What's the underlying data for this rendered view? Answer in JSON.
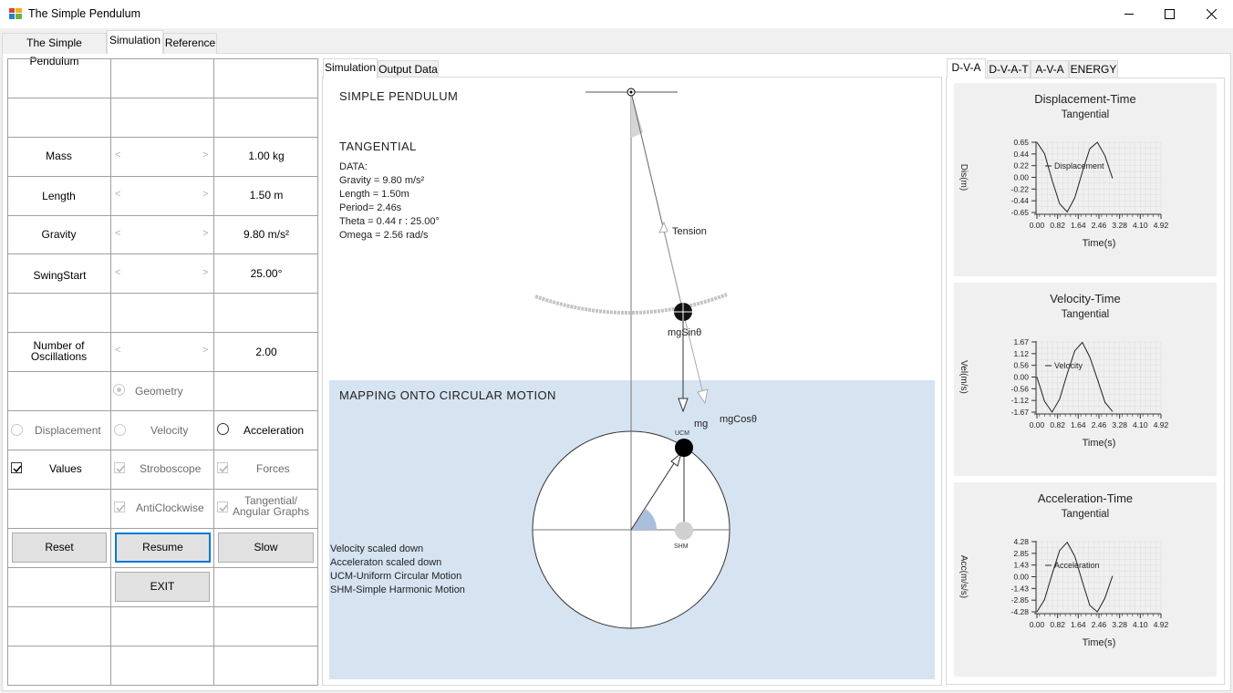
{
  "window": {
    "title": "The Simple Pendulum"
  },
  "main_tabs": [
    "The Simple Pendulum",
    "Simulation",
    "Reference"
  ],
  "controls": {
    "mass": {
      "label": "Mass",
      "value": "1.00 kg"
    },
    "length": {
      "label": "Length",
      "value": "1.50 m"
    },
    "gravity": {
      "label": "Gravity",
      "value": "9.80 m/s²"
    },
    "swing": {
      "label": "SwingStart",
      "value": "25.00°"
    },
    "osc": {
      "label1": "Number of",
      "label2": "Oscillations",
      "value": "2.00"
    },
    "geometry": "Geometry",
    "displacement": "Displacement",
    "velocity": "Velocity",
    "acceleration": "Acceleration",
    "values": "Values",
    "stroboscope": "Stroboscope",
    "forces": "Forces",
    "anticlockwise": "AntiClockwise",
    "tangential1": "Tangential/",
    "tangential2": "Angular Graphs",
    "reset": "Reset",
    "resume": "Resume",
    "slow": "Slow",
    "exit": "EXIT"
  },
  "sim_tabs": [
    "Simulation",
    "Output Data"
  ],
  "sim": {
    "heading": "SIMPLE PENDULUM",
    "mode": "TANGENTIAL",
    "data_lines": [
      "DATA:",
      "Gravity = 9.80 m/s²",
      "Length = 1.50m",
      "Period= 2.46s",
      "Theta = 0.44 r : 25.00°",
      "Omega = 2.56 rad/s"
    ],
    "tension": "Tension",
    "mgsin": "mgSinθ",
    "mg": "mg",
    "mgcos": "mgCosθ",
    "circ_heading": "MAPPING ONTO CIRCULAR MOTION",
    "ucm": "UCM",
    "shm": "SHM",
    "notes": [
      "Velocity scaled down",
      "Acceleraton scaled down",
      "UCM-Uniform Circular Motion",
      "SHM-Simple Harmonic Motion"
    ]
  },
  "graph_tabs": [
    "D-V-A",
    "D-V-A-T",
    "A-V-A",
    "ENERGY"
  ],
  "graphs": [
    {
      "title": "Displacement-Time",
      "sub": "Tangential",
      "ylabel": "Dis(m)",
      "xlabel": "Time(s)",
      "legend": "Displacement",
      "yticks": [
        "0.65",
        "0.44",
        "0.22",
        "0.00",
        "-0.22",
        "-0.44",
        "-0.65"
      ],
      "xticks": [
        "0.00",
        "0.82",
        "1.64",
        "2.46",
        "3.28",
        "4.10",
        "4.92"
      ]
    },
    {
      "title": "Velocity-Time",
      "sub": "Tangential",
      "ylabel": "Vel(m/s)",
      "xlabel": "Time(s)",
      "legend": "Velocity",
      "yticks": [
        "1.67",
        "1.12",
        "0.56",
        "0.00",
        "-0.56",
        "-1.12",
        "-1.67"
      ],
      "xticks": [
        "0.00",
        "0.82",
        "1.64",
        "2.46",
        "3.28",
        "4.10",
        "4.92"
      ]
    },
    {
      "title": "Acceleration-Time",
      "sub": "Tangential",
      "ylabel": "Acc(m/s/s)",
      "xlabel": "Time(s)",
      "legend": "Acceleration",
      "yticks": [
        "4.28",
        "2.85",
        "1.43",
        "0.00",
        "-1.43",
        "-2.85",
        "-4.28"
      ],
      "xticks": [
        "0.00",
        "0.82",
        "1.64",
        "2.46",
        "3.28",
        "4.10",
        "4.92"
      ]
    }
  ],
  "chart_data": [
    {
      "type": "line",
      "title": "Displacement-Time",
      "subtitle": "Tangential",
      "xlabel": "Time(s)",
      "ylabel": "Dis(m)",
      "xlim": [
        0,
        4.92
      ],
      "ylim": [
        -0.65,
        0.65
      ],
      "grid": true,
      "series": [
        {
          "name": "Displacement",
          "x": [
            0,
            0.3,
            0.6,
            0.9,
            1.2,
            1.5,
            1.8,
            2.1,
            2.4,
            2.7,
            3.0
          ],
          "y": [
            0.65,
            0.44,
            -0.05,
            -0.49,
            -0.64,
            -0.38,
            0.1,
            0.53,
            0.65,
            0.4,
            -0.02
          ]
        }
      ]
    },
    {
      "type": "line",
      "title": "Velocity-Time",
      "subtitle": "Tangential",
      "xlabel": "Time(s)",
      "ylabel": "Vel(m/s)",
      "xlim": [
        0,
        4.92
      ],
      "ylim": [
        -1.67,
        1.67
      ],
      "grid": true,
      "series": [
        {
          "name": "Velocity",
          "x": [
            0,
            0.3,
            0.6,
            0.9,
            1.2,
            1.5,
            1.8,
            2.1,
            2.4,
            2.7,
            3.0
          ],
          "y": [
            0,
            -1.15,
            -1.67,
            -1.05,
            0.15,
            1.25,
            1.65,
            0.95,
            -0.1,
            -1.2,
            -1.64
          ]
        }
      ]
    },
    {
      "type": "line",
      "title": "Acceleration-Time",
      "subtitle": "Tangential",
      "xlabel": "Time(s)",
      "ylabel": "Acc(m/s/s)",
      "xlim": [
        0,
        4.92
      ],
      "ylim": [
        -4.28,
        4.28
      ],
      "grid": true,
      "series": [
        {
          "name": "Acceleration",
          "x": [
            0,
            0.3,
            0.6,
            0.9,
            1.2,
            1.5,
            1.8,
            2.1,
            2.4,
            2.7,
            3.0
          ],
          "y": [
            -4.28,
            -2.8,
            0.3,
            3.2,
            4.2,
            2.5,
            -0.6,
            -3.5,
            -4.28,
            -2.6,
            0.1
          ]
        }
      ]
    }
  ]
}
